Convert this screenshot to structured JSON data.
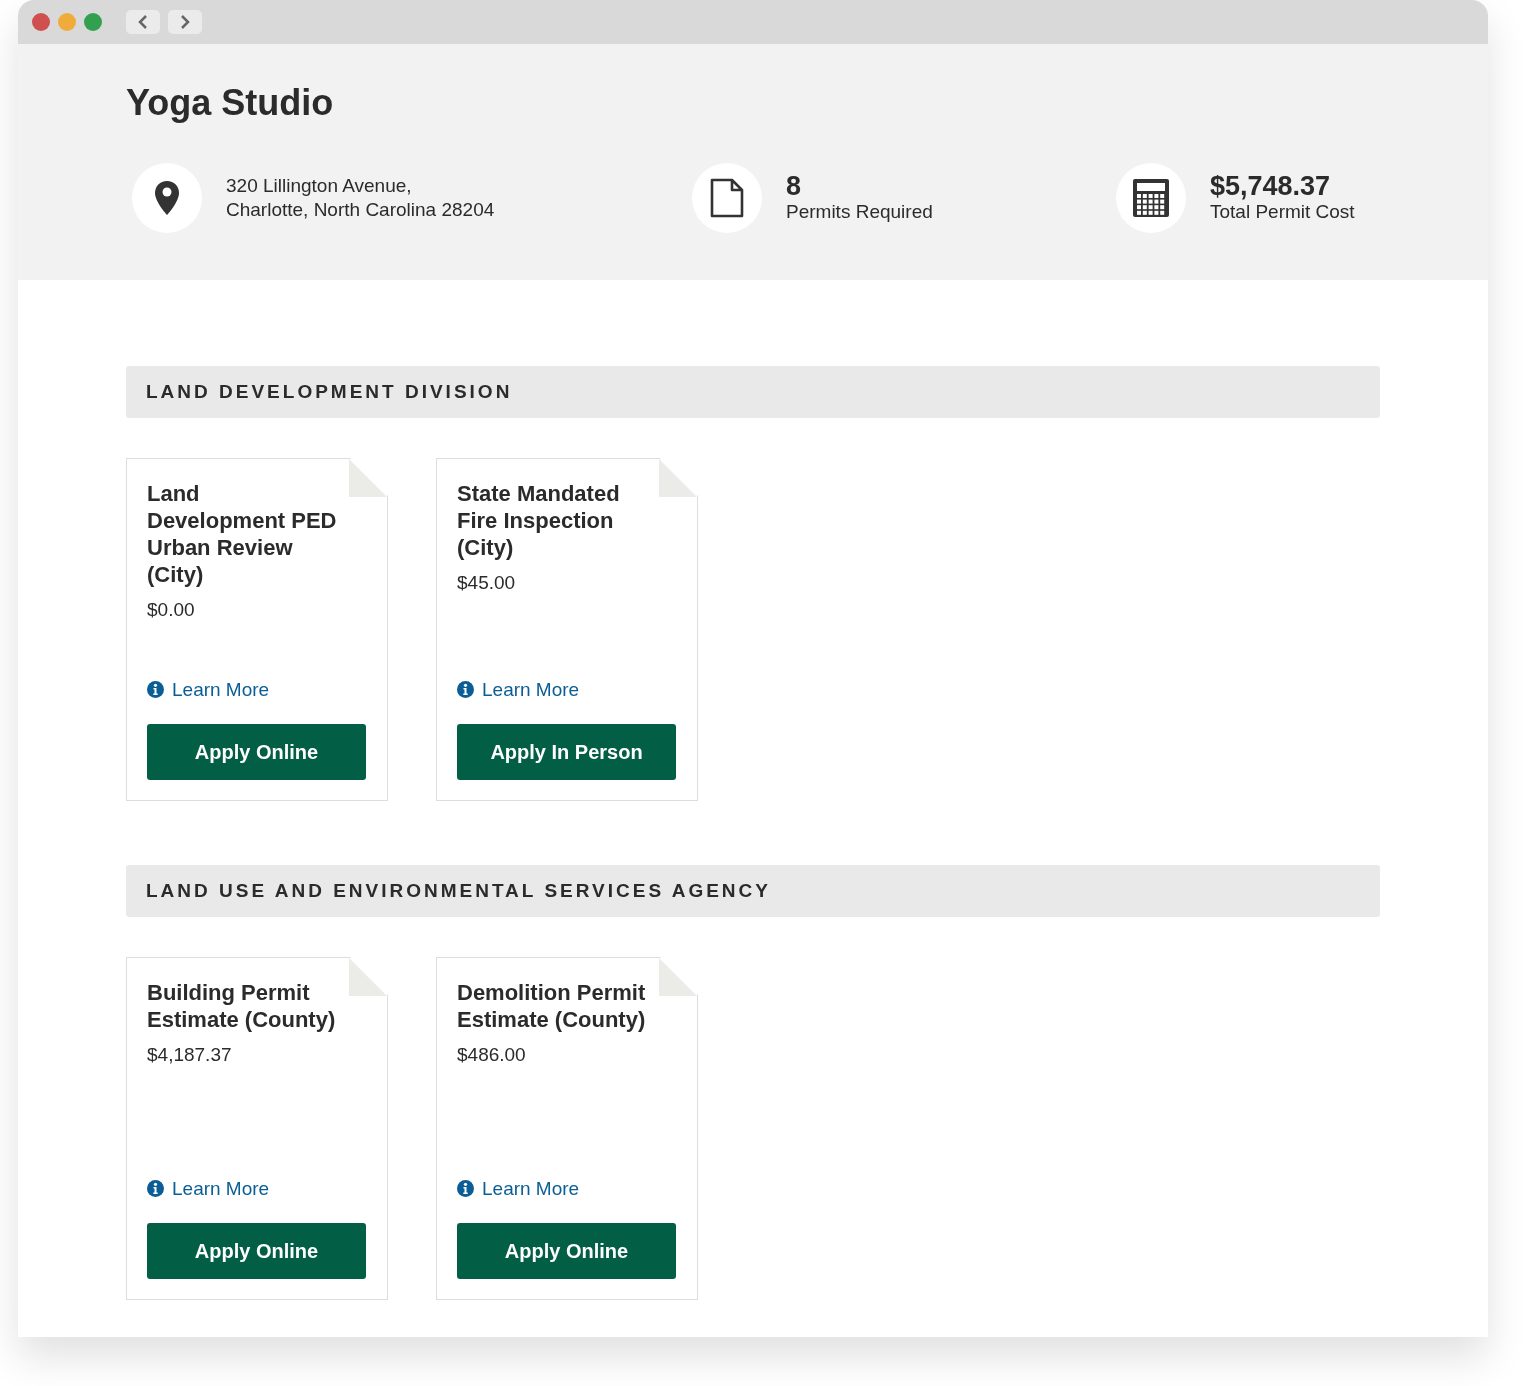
{
  "header": {
    "title": "Yoga Studio",
    "stats": [
      {
        "kind": "address",
        "lines": [
          "320 Lillington Avenue,",
          "Charlotte, North Carolina 28204"
        ]
      },
      {
        "kind": "permits",
        "value": "8",
        "label": "Permits Required"
      },
      {
        "kind": "cost",
        "value": "$5,748.37",
        "label": "Total Permit Cost"
      }
    ]
  },
  "sections": [
    {
      "heading": "LAND DEVELOPMENT DIVISION",
      "permits": [
        {
          "title": "Land Development PED Urban Review (City)",
          "cost": "$0.00",
          "link": "Learn More",
          "action": "Apply Online"
        },
        {
          "title": "State Mandated Fire Inspection (City)",
          "cost": "$45.00",
          "link": "Learn More",
          "action": "Apply In Person"
        }
      ]
    },
    {
      "heading": "LAND USE AND ENVIRONMENTAL SERVICES AGENCY",
      "permits": [
        {
          "title": "Building Permit Estimate (County)",
          "cost": "$4,187.37",
          "link": "Learn More",
          "action": "Apply Online"
        },
        {
          "title": "Demolition Permit Estimate (County)",
          "cost": "$486.00",
          "link": "Learn More",
          "action": "Apply Online"
        }
      ]
    }
  ]
}
